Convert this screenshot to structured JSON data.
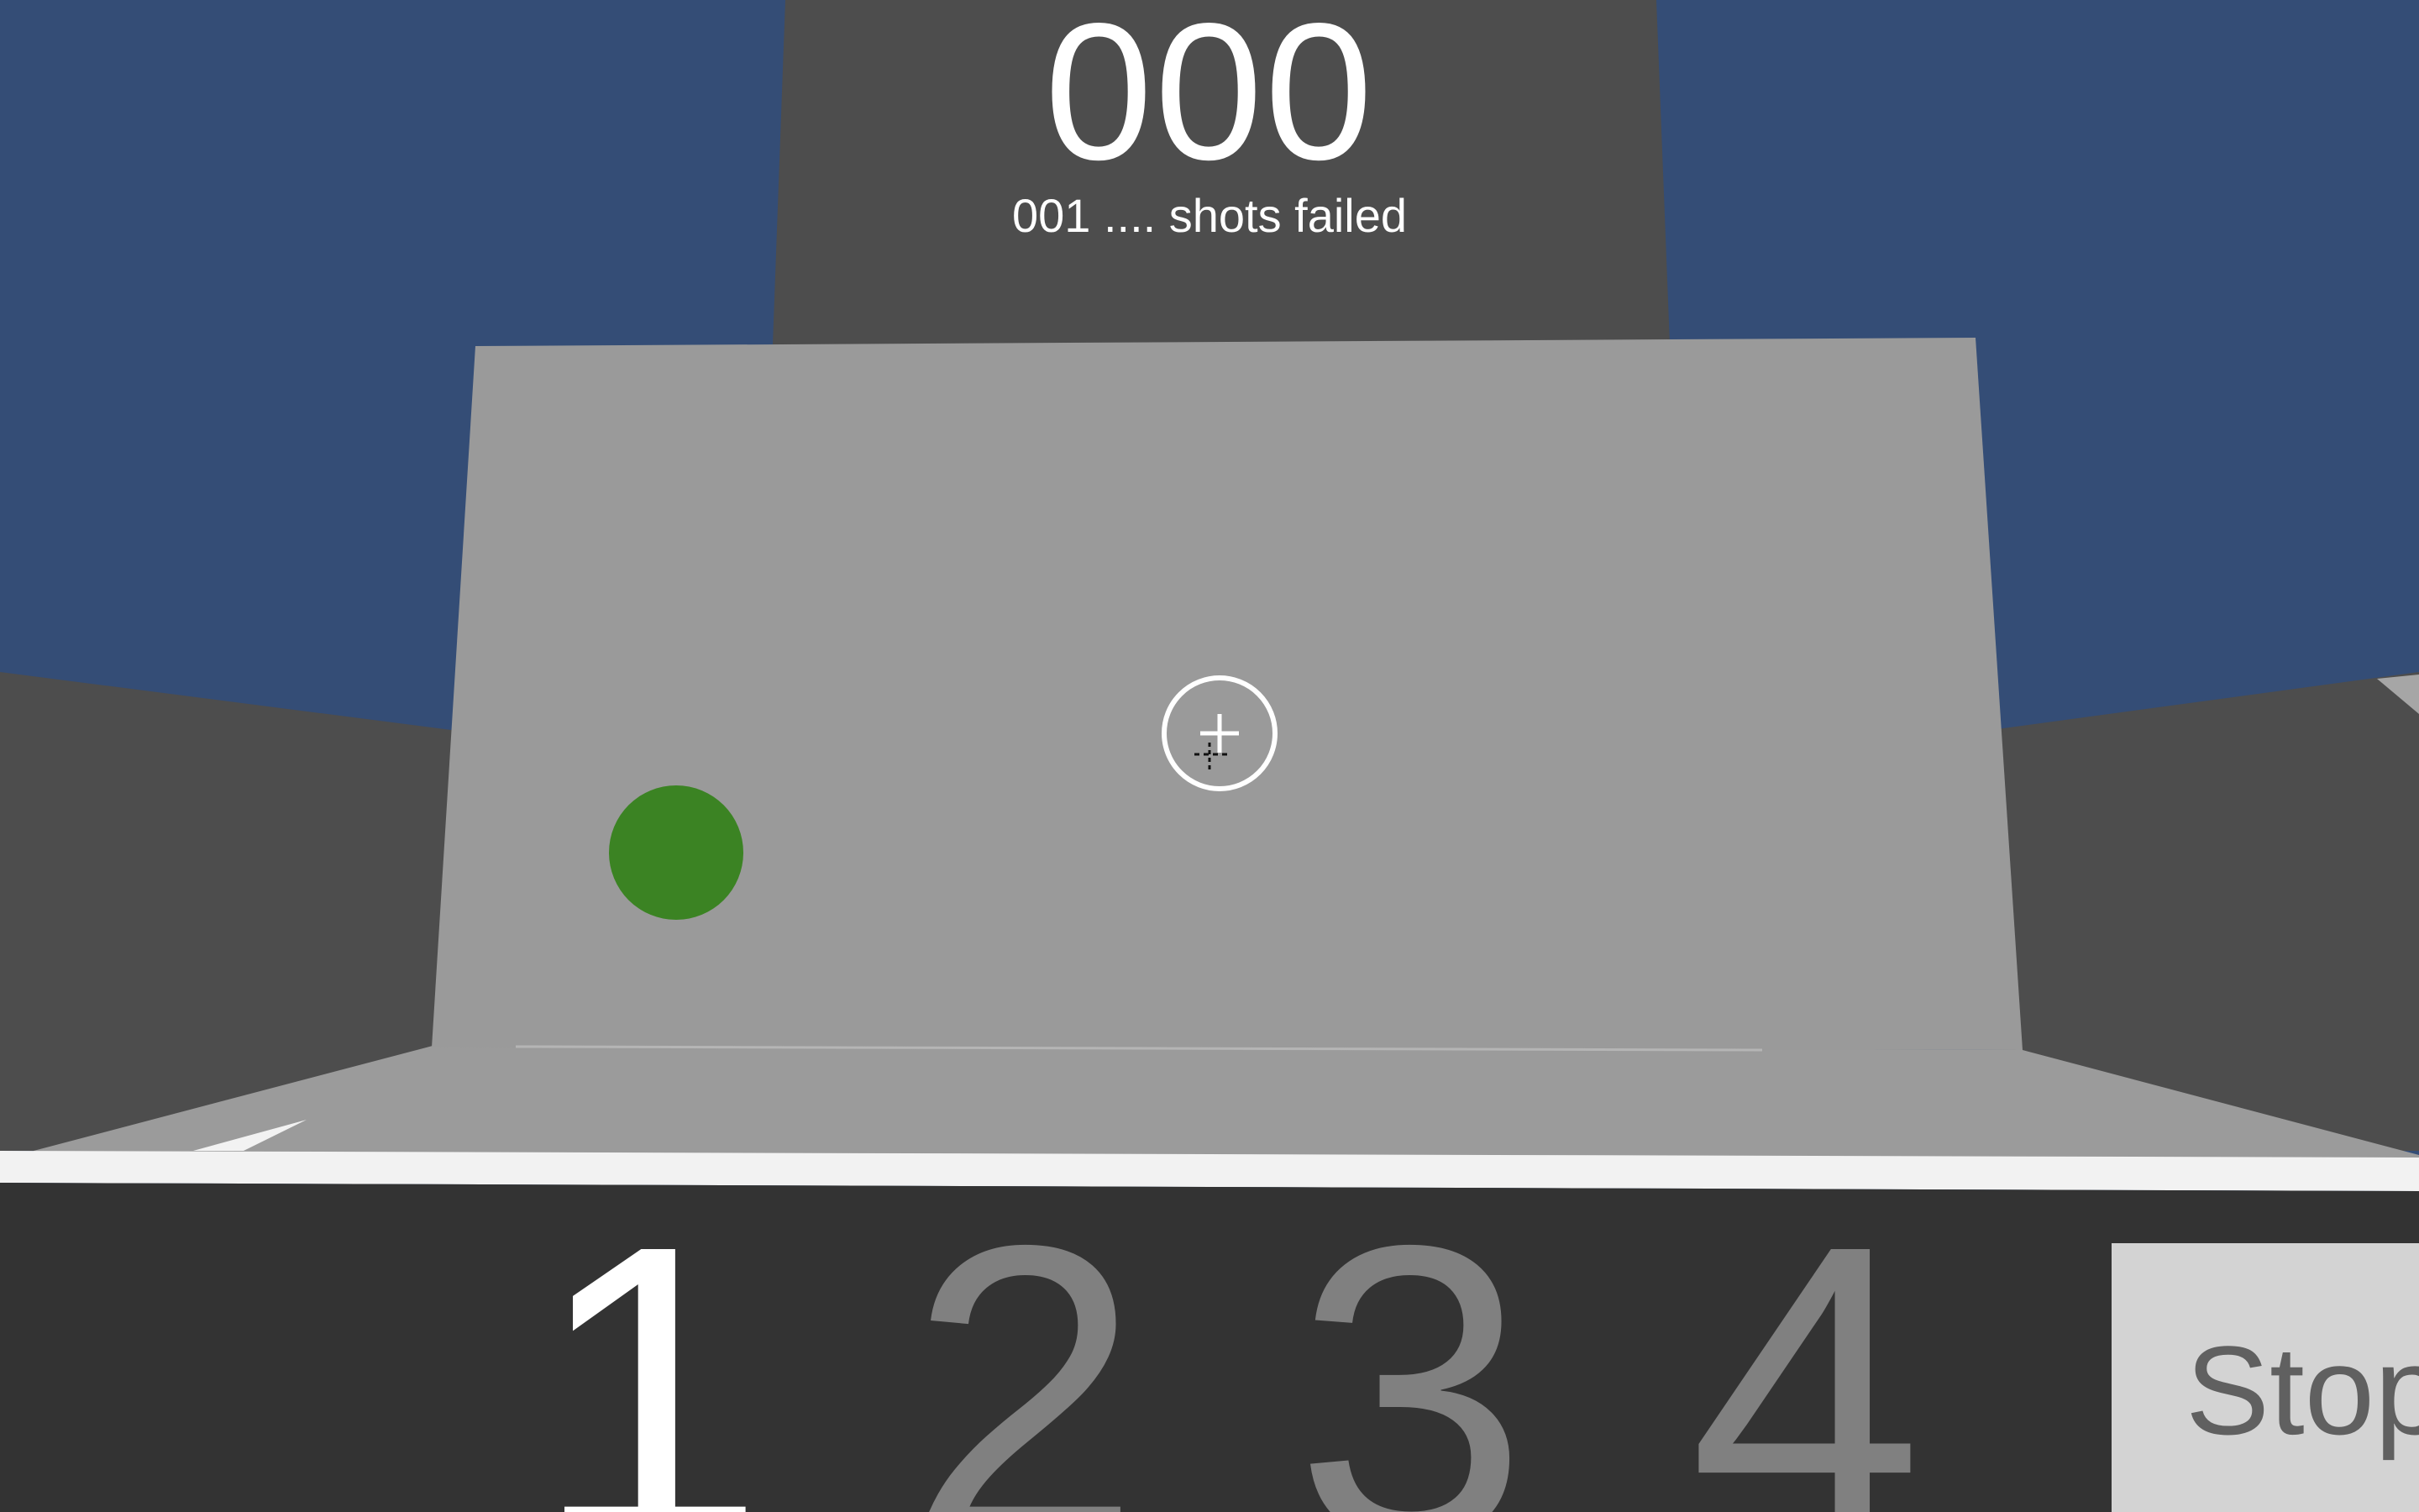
{
  "hud": {
    "score": "000",
    "shots_failed": "001 .... shots failed"
  },
  "weapon_slots": [
    {
      "label": "1",
      "selected": true
    },
    {
      "label": "2",
      "selected": false
    },
    {
      "label": "3",
      "selected": false
    },
    {
      "label": "4",
      "selected": false
    }
  ],
  "stop_button": {
    "label": "Stop"
  },
  "crosshair": {
    "icon": "crosshair-icon"
  },
  "target": {
    "color": "#3b8323"
  },
  "colors": {
    "sky": "#344d76",
    "tower": "#4d4d4d",
    "wall": "#9a9a9a",
    "floor": "#9b9b9b",
    "bar": "#333333",
    "rail": "#f2f2f2"
  }
}
